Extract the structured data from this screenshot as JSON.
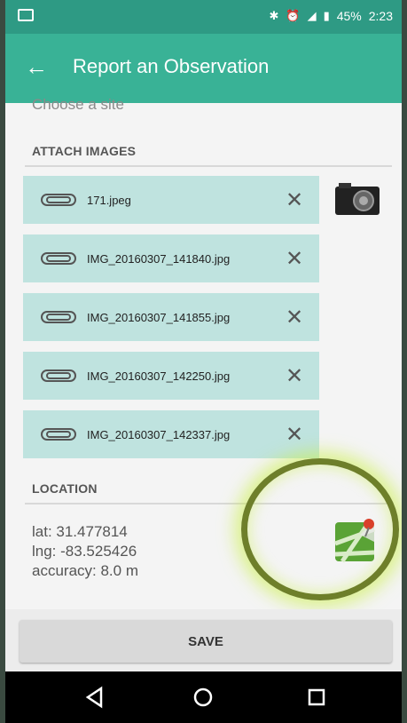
{
  "status_bar": {
    "battery": "45%",
    "time": "2:23"
  },
  "app_bar": {
    "title": "Report an Observation",
    "back_icon": "arrow-back-icon"
  },
  "site_hint": "Choose a site",
  "attach": {
    "section_title": "ATTACH IMAGES",
    "files": [
      "171.jpeg",
      "IMG_20160307_141840.jpg",
      "IMG_20160307_141855.jpg",
      "IMG_20160307_142250.jpg",
      "IMG_20160307_142337.jpg"
    ],
    "remove_symbol": "✕"
  },
  "location": {
    "section_title": "LOCATION",
    "lat": "lat:  31.477814",
    "lng": "lng: -83.525426",
    "accuracy": "accuracy:  8.0 m"
  },
  "save_label": "SAVE",
  "colors": {
    "toolbar": "#39b296",
    "statusbar": "#2e9a84",
    "attachment_row": "#bfe3df",
    "highlight": "#6e7f2a"
  }
}
